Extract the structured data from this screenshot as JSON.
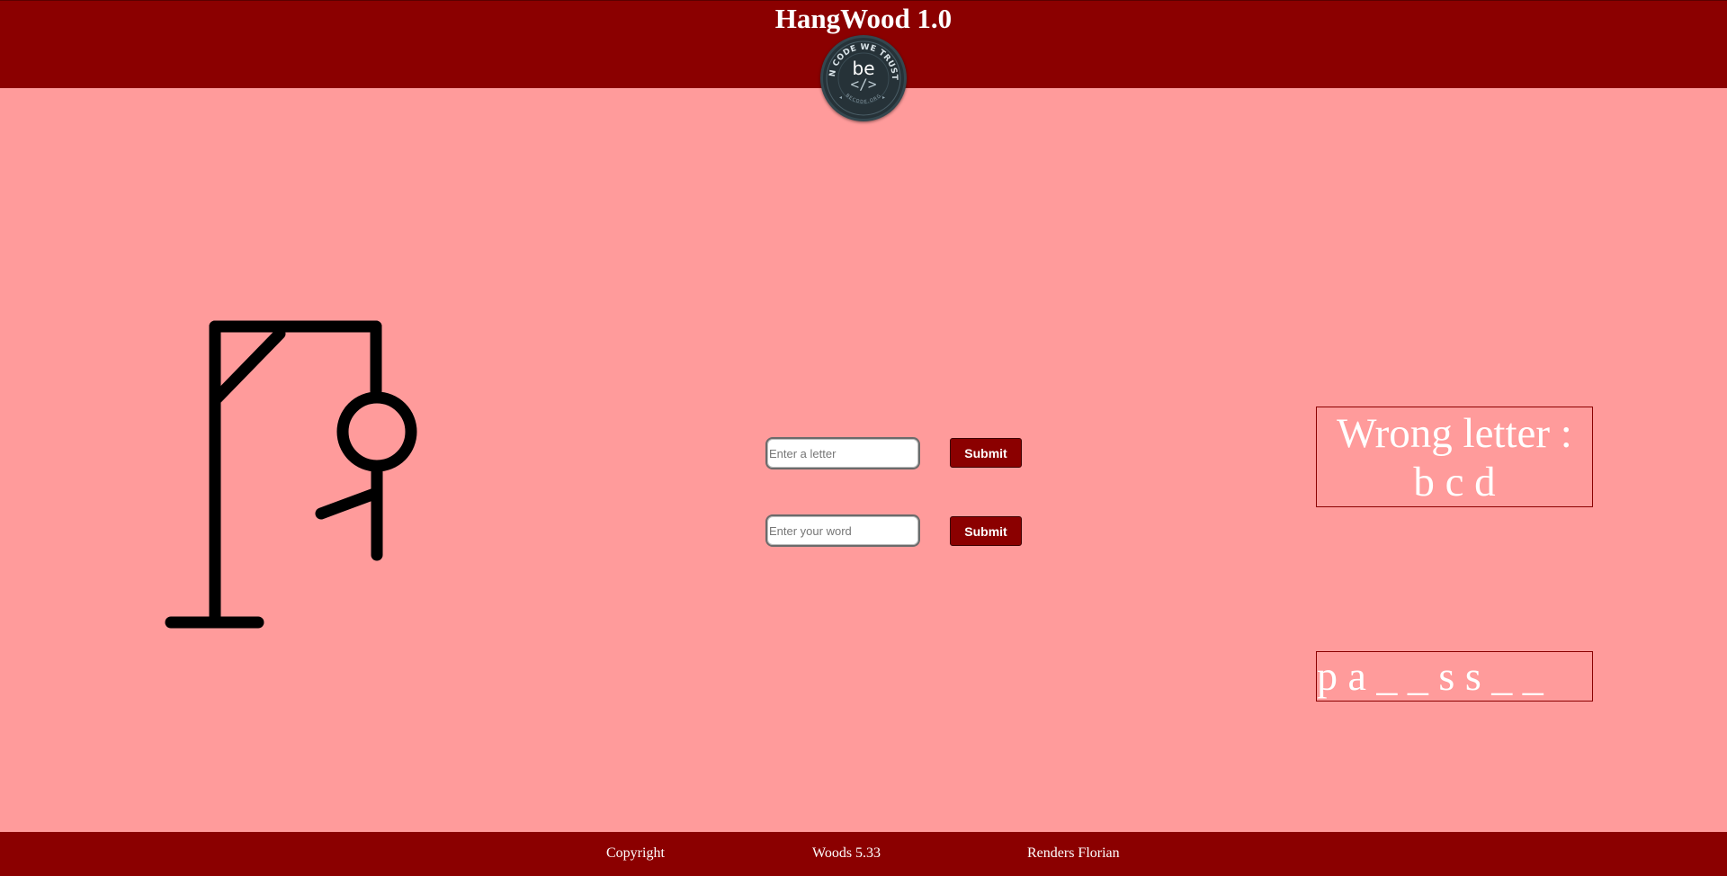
{
  "header": {
    "title": "HangWood 1.0",
    "logo": {
      "icon": "be-code-logo-icon",
      "arc_text": "IN CODE WE TRUST",
      "main_text": "be",
      "code_text": "</>",
      "bottom_text": "BECODE.ORG"
    }
  },
  "game": {
    "hangman_icon": "hangman-gallows-icon",
    "letter_input": {
      "placeholder": "Enter a letter",
      "value": ""
    },
    "letter_submit_label": "Submit",
    "word_input": {
      "placeholder": "Enter your word",
      "value": ""
    },
    "word_submit_label": "Submit",
    "wrong_letters": {
      "label": "Wrong letter :",
      "letters": "b c d"
    },
    "word_display": "p a _ _ s s _ _"
  },
  "footer": {
    "copyright": "Copyright",
    "version": "Woods 5.33",
    "credits": "Renders Florian"
  },
  "colors": {
    "bar": "#8b0000",
    "background": "#ff9b9b",
    "text_light": "#ffffff",
    "drawing": "#000000"
  }
}
